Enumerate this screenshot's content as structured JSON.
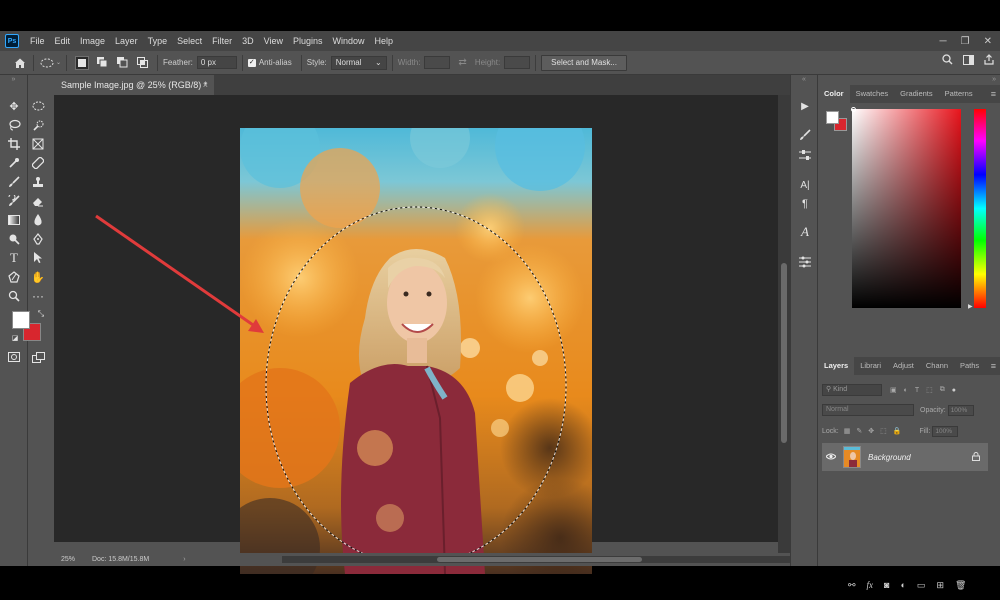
{
  "menubar": {
    "app_icon": "Ps",
    "items": [
      "File",
      "Edit",
      "Image",
      "Layer",
      "Type",
      "Select",
      "Filter",
      "3D",
      "View",
      "Plugins",
      "Window",
      "Help"
    ],
    "window_controls": [
      "─",
      "❐",
      "✕"
    ]
  },
  "options": {
    "feather_label": "Feather:",
    "feather_value": "0 px",
    "antialias_label": "Anti-alias",
    "style_label": "Style:",
    "style_value": "Normal",
    "width_label": "Width:",
    "height_label": "Height:",
    "select_mask_label": "Select and Mask..."
  },
  "document": {
    "tab_title": "Sample Image.jpg @ 25% (RGB/8) *",
    "tab_close": "×",
    "zoom": "25%",
    "doc_info": "Doc: 15.8M/15.8M"
  },
  "color_panel": {
    "tabs": [
      "Color",
      "Swatches",
      "Gradients",
      "Patterns"
    ],
    "foreground": "#ffffff",
    "background": "#d8262e"
  },
  "layers_panel": {
    "tabs": [
      "Layers",
      "Librari",
      "Adjust",
      "Chann",
      "Paths"
    ],
    "kind_placeholder": "Kind",
    "blend_mode": "Normal",
    "opacity_label": "Opacity:",
    "opacity_value": "100%",
    "lock_label": "Lock:",
    "fill_label": "Fill:",
    "fill_value": "100%",
    "layers": [
      {
        "name": "Background",
        "visible": true,
        "locked": true
      }
    ]
  },
  "icons": {
    "home": "home-icon",
    "marquee": "elliptical-marquee-icon",
    "search": "search-icon",
    "share": "share-icon",
    "visibility": "eye-icon",
    "lock": "lock-icon"
  },
  "colors": {
    "ui_bg": "#535353",
    "canvas_bg": "#282828",
    "annotation_arrow": "#e03b3b"
  }
}
